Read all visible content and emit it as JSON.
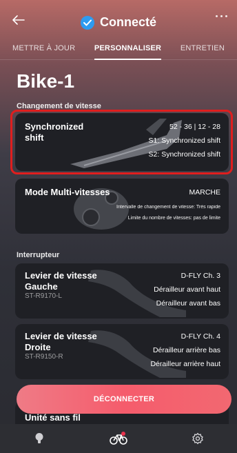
{
  "header": {
    "status_text": "Connecté",
    "colors": {
      "status_check": "#2d9bf0"
    }
  },
  "tabs": [
    {
      "label": "METTRE À JOUR"
    },
    {
      "label": "PERSONNALISER",
      "active": true
    },
    {
      "label": "ENTRETIEN"
    }
  ],
  "page": {
    "title": "Bike-1"
  },
  "sections": {
    "shifting": "Changement de vitesse",
    "switch": "Interrupteur"
  },
  "cards": {
    "sync_shift": {
      "name_line1": "Synchronized",
      "name_line2": "shift",
      "line1": "52 - 36 | 12 - 28",
      "line2": "S1: Synchronized shift",
      "line3": "S2: Synchronized shift"
    },
    "multi_shift": {
      "name": "Mode Multi-vitesses",
      "status": "MARCHE",
      "interval": "Intervalle de changement de vitesse: Très rapide",
      "limit": "Limite du nombre de vitesses: pas de limite"
    },
    "left_lever": {
      "name_line1": "Levier de vitesse",
      "name_line2": "Gauche",
      "model": "ST-R9170-L",
      "line1": "D-FLY Ch. 3",
      "line2": "Dérailleur avant haut",
      "line3": "Dérailleur avant bas"
    },
    "right_lever": {
      "name_line1": "Levier de vitesse",
      "name_line2": "Droite",
      "model": "ST-R9150-R",
      "line1": "D-FLY Ch. 4",
      "line2": "Dérailleur arrière bas",
      "line3": "Dérailleur arrière haut"
    },
    "wireless": {
      "name": "Unité sans fil"
    }
  },
  "actions": {
    "disconnect": "DÉCONNECTER"
  },
  "bottom_nav": [
    {
      "icon": "lightbulb-icon"
    },
    {
      "icon": "bike-icon",
      "active": true,
      "badge_color": "#e9334d"
    },
    {
      "icon": "gear-icon"
    }
  ]
}
